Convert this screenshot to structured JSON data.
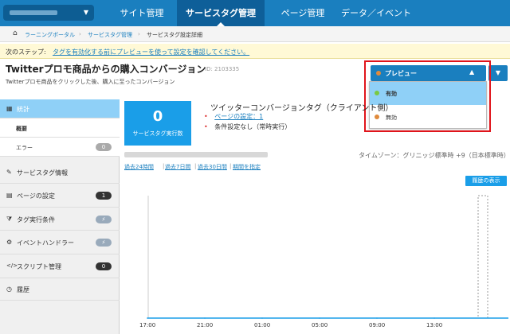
{
  "nav": {
    "items": [
      {
        "label": "サイト管理",
        "active": false
      },
      {
        "label": "サービスタグ管理",
        "active": true
      },
      {
        "label": "ページ管理",
        "active": false
      },
      {
        "label": "データ／イベント",
        "active": false
      }
    ]
  },
  "breadcrumb": [
    "ラーニングポータル",
    "サービスタグ管理",
    "サービスタグ設定詳細"
  ],
  "next_step": {
    "prefix": "次のステップ:",
    "link": "タグを有効化する前にプレビューを使って設定を確認してください。"
  },
  "page": {
    "title": "Twitterプロモ商品からの購入コンバージョン",
    "id_text": "ID: 2103335",
    "subtitle": "Twitterプロモ商品をクリックした後、購入に至ったコンバージョン"
  },
  "preview": {
    "label": "プレビュー",
    "options": [
      {
        "label": "有効",
        "dot_color": "#7ac943",
        "selected": true
      },
      {
        "label": "無効",
        "dot_color": "#e08a3c",
        "selected": false
      }
    ],
    "current_dot_color": "#e08a3c"
  },
  "sidebar": {
    "stats": "統計",
    "overview": "概要",
    "errors": "エラー",
    "errors_count": "0",
    "service_tag_info": "サービスタグ情報",
    "page_settings": "ページの設定",
    "page_settings_count": "1",
    "tag_conditions": "タグ実行条件",
    "event_handlers": "イベントハンドラー",
    "script_management": "スクリプト管理",
    "script_count": "0",
    "history": "履歴"
  },
  "kpi": {
    "value": "0",
    "label": "サービスタグ実行数"
  },
  "tag": {
    "name": "ツイッターコンバージョンタグ（クライアント側）",
    "page_settings_link": "ページの設定：1",
    "condition": "条件設定なし（常時実行）"
  },
  "timezone": "タイムゾーン：グリニッジ標準時 +9（日本標準時）",
  "periods": [
    "過去24時間",
    "過去7日間",
    "過去30日間",
    "期間を指定"
  ],
  "history_button": "履歴の表示",
  "chart_data": {
    "type": "line",
    "x": [
      "17:00",
      "21:00",
      "01:00",
      "05:00",
      "09:00",
      "13:00"
    ],
    "series": [
      {
        "values": [
          0,
          0,
          0,
          0,
          0,
          0
        ]
      }
    ]
  }
}
